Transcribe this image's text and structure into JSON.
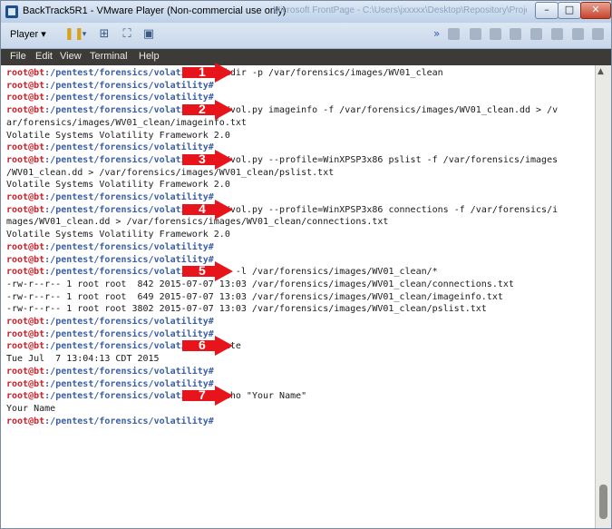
{
  "window": {
    "title": "BackTrack5R1 - VMware Player (Non-commercial use only)",
    "bg_title_ghost": "Microsoft FrontPage - C:\\Users\\jxxxxx\\Desktop\\Repository\\Projects"
  },
  "toolbar": {
    "player_label": "Player"
  },
  "menu": [
    "File",
    "Edit",
    "View",
    "Terminal",
    "Help"
  ],
  "prompt": {
    "user": "root@bt",
    "path": ":/pentest/forensics/volatility",
    "symbol": "#"
  },
  "colors": {
    "prompt_user": "#d1202a",
    "prompt_path": "#3a5fa8",
    "arrow": "#e8141b",
    "menubar": "#3c3b37"
  },
  "lines": [
    {
      "p": true,
      "cmd": " mkdir -p /var/forensics/images/WV01_clean"
    },
    {
      "p": true,
      "cmd": ""
    },
    {
      "p": true,
      "cmd": ""
    },
    {
      "p": true,
      "cmd": " ./vol.py imageinfo -f /var/forensics/images/WV01_clean.dd > /v"
    },
    {
      "p": false,
      "cmd": "ar/forensics/images/WV01_clean/imageinfo.txt"
    },
    {
      "p": false,
      "cmd": "Volatile Systems Volatility Framework 2.0"
    },
    {
      "p": true,
      "cmd": ""
    },
    {
      "p": true,
      "cmd": " ./vol.py --profile=WinXPSP3x86 pslist -f /var/forensics/images"
    },
    {
      "p": false,
      "cmd": "/WV01_clean.dd > /var/forensics/images/WV01_clean/pslist.txt"
    },
    {
      "p": false,
      "cmd": "Volatile Systems Volatility Framework 2.0"
    },
    {
      "p": true,
      "cmd": ""
    },
    {
      "p": true,
      "cmd": " ./vol.py --profile=WinXPSP3x86 connections -f /var/forensics/i"
    },
    {
      "p": false,
      "cmd": "mages/WV01_clean.dd > /var/forensics/images/WV01_clean/connections.txt"
    },
    {
      "p": false,
      "cmd": "Volatile Systems Volatility Framework 2.0"
    },
    {
      "p": true,
      "cmd": ""
    },
    {
      "p": true,
      "cmd": ""
    },
    {
      "p": true,
      "cmd": " ls -l /var/forensics/images/WV01_clean/*"
    },
    {
      "p": false,
      "cmd": "-rw-r--r-- 1 root root  842 2015-07-07 13:03 /var/forensics/images/WV01_clean/connections.txt"
    },
    {
      "p": false,
      "cmd": "-rw-r--r-- 1 root root  649 2015-07-07 13:03 /var/forensics/images/WV01_clean/imageinfo.txt"
    },
    {
      "p": false,
      "cmd": "-rw-r--r-- 1 root root 3802 2015-07-07 13:03 /var/forensics/images/WV01_clean/pslist.txt"
    },
    {
      "p": true,
      "cmd": ""
    },
    {
      "p": true,
      "cmd": ""
    },
    {
      "p": true,
      "cmd": " date"
    },
    {
      "p": false,
      "cmd": "Tue Jul  7 13:04:13 CDT 2015"
    },
    {
      "p": true,
      "cmd": ""
    },
    {
      "p": true,
      "cmd": ""
    },
    {
      "p": true,
      "cmd": " echo \"Your Name\""
    },
    {
      "p": false,
      "cmd": "Your Name"
    },
    {
      "p": true,
      "cmd": ""
    }
  ],
  "arrows": [
    {
      "label": "1",
      "line": 0
    },
    {
      "label": "2",
      "line": 3
    },
    {
      "label": "3",
      "line": 7
    },
    {
      "label": "4",
      "line": 11
    },
    {
      "label": "5",
      "line": 16
    },
    {
      "label": "6",
      "line": 22
    },
    {
      "label": "7",
      "line": 26
    }
  ]
}
